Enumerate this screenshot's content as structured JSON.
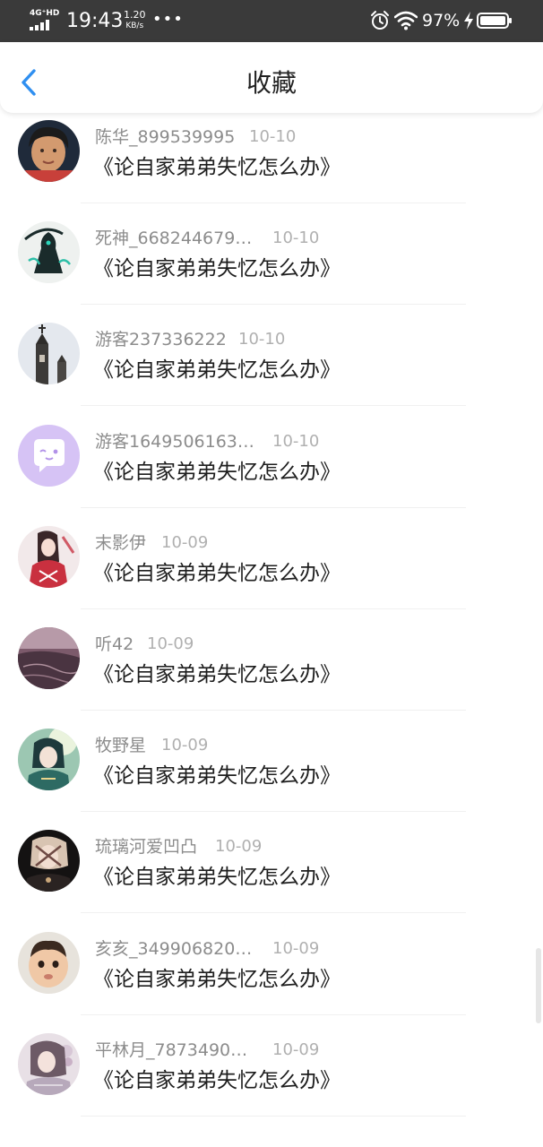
{
  "status_bar": {
    "network_label": "4G⁺HD",
    "time": "19:43",
    "speed_value": "1.20",
    "speed_unit": "KB/s",
    "dots": "•••",
    "battery_percent": "97%",
    "colors": {
      "background": "#3a3a3a",
      "foreground": "#ffffff"
    },
    "icons": [
      "signal-icon",
      "alarm-icon",
      "wifi-icon",
      "charging-icon",
      "battery-icon"
    ]
  },
  "header": {
    "title": "收藏",
    "back_icon": "chevron-left-icon",
    "accent_color": "#2f8ff0"
  },
  "items": [
    {
      "name": "陈华_899539995",
      "date": "10-10",
      "title": "《论自家弟弟失忆怎么办》",
      "avatar": "portrait-photo"
    },
    {
      "name": "死神_668244679…",
      "date": "10-10",
      "title": "《论自家弟弟失忆怎么办》",
      "avatar": "reaper-figure"
    },
    {
      "name": "游客237336222",
      "date": "10-10",
      "title": "《论自家弟弟失忆怎么办》",
      "avatar": "church-spire"
    },
    {
      "name": "游客1649506163…",
      "date": "10-10",
      "title": "《论自家弟弟失忆怎么办》",
      "avatar": "default-chat-bubble"
    },
    {
      "name": "末影伊",
      "date": "10-09",
      "title": "《论自家弟弟失忆怎么办》",
      "avatar": "anime-girl"
    },
    {
      "name": "听42",
      "date": "10-09",
      "title": "《论自家弟弟失忆怎么办》",
      "avatar": "purple-landscape"
    },
    {
      "name": "牧野星",
      "date": "10-09",
      "title": "《论自家弟弟失忆怎么办》",
      "avatar": "anime-boy-green"
    },
    {
      "name": "琉璃河爱凹凸",
      "date": "10-09",
      "title": "《论自家弟弟失忆怎么办》",
      "avatar": "anime-dark"
    },
    {
      "name": "亥亥_349906820…",
      "date": "10-09",
      "title": "《论自家弟弟失忆怎么办》",
      "avatar": "baby-photo"
    },
    {
      "name": "平林月_7873490…",
      "date": "10-09",
      "title": "《论自家弟弟失忆怎么办》",
      "avatar": "anime-floral"
    }
  ]
}
